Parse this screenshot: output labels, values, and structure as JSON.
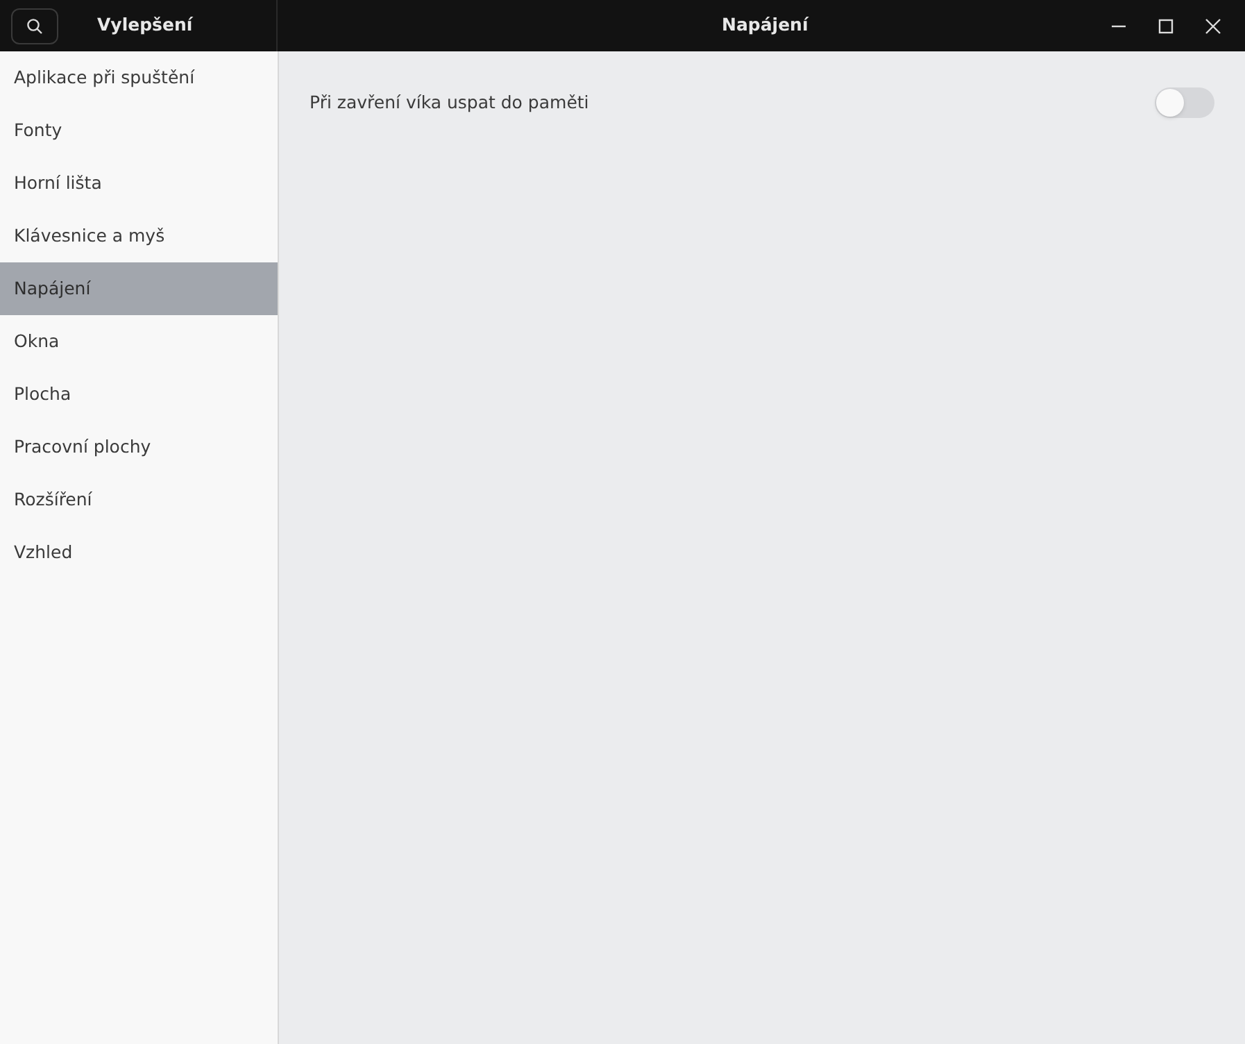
{
  "sidebar": {
    "title": "Vylepšení",
    "items": [
      {
        "label": "Aplikace při spuštění",
        "selected": false
      },
      {
        "label": "Fonty",
        "selected": false
      },
      {
        "label": "Horní lišta",
        "selected": false
      },
      {
        "label": "Klávesnice a myš",
        "selected": false
      },
      {
        "label": "Napájení",
        "selected": true
      },
      {
        "label": "Okna",
        "selected": false
      },
      {
        "label": "Plocha",
        "selected": false
      },
      {
        "label": "Pracovní plochy",
        "selected": false
      },
      {
        "label": "Rozšíření",
        "selected": false
      },
      {
        "label": "Vzhled",
        "selected": false
      }
    ]
  },
  "window": {
    "title": "Napájení"
  },
  "settings": [
    {
      "label": "Při zavření víka uspat do paměti",
      "on": false
    }
  ]
}
